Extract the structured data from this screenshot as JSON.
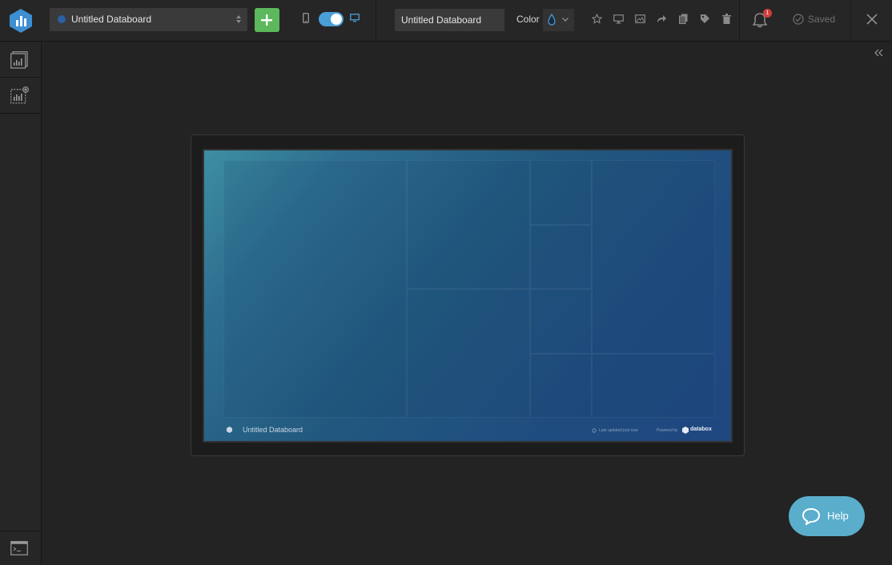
{
  "topbar": {
    "databoard_select": "Untitled Databoard",
    "title_value": "Untitled Databoard",
    "color_label": "Color",
    "notifications_count": "1",
    "saved_label": "Saved"
  },
  "icons": {
    "logo": "databox-logo-icon",
    "add": "plus-icon",
    "mobile": "mobile-icon",
    "desktop": "desktop-icon",
    "favorite": "star-icon",
    "present": "monitor-icon",
    "image": "image-icon",
    "share": "share-icon",
    "clone": "copy-icon",
    "tag": "tag-icon",
    "delete": "trash-icon",
    "notifications": "bell-icon",
    "close": "close-icon",
    "collapse": "double-chevron-left-icon",
    "help": "chat-bubble-icon"
  },
  "toggle": {
    "desktop_enabled": true
  },
  "preview": {
    "title": "Untitled Databoard",
    "last_updated": "Last updated just now",
    "powered_by": "Powered by",
    "brand": "databox"
  },
  "help": {
    "label": "Help"
  },
  "colors": {
    "accent": "#5cb85c",
    "toggle": "#4a9fd8",
    "help": "#5aaecb",
    "badge": "#d23d3d"
  }
}
